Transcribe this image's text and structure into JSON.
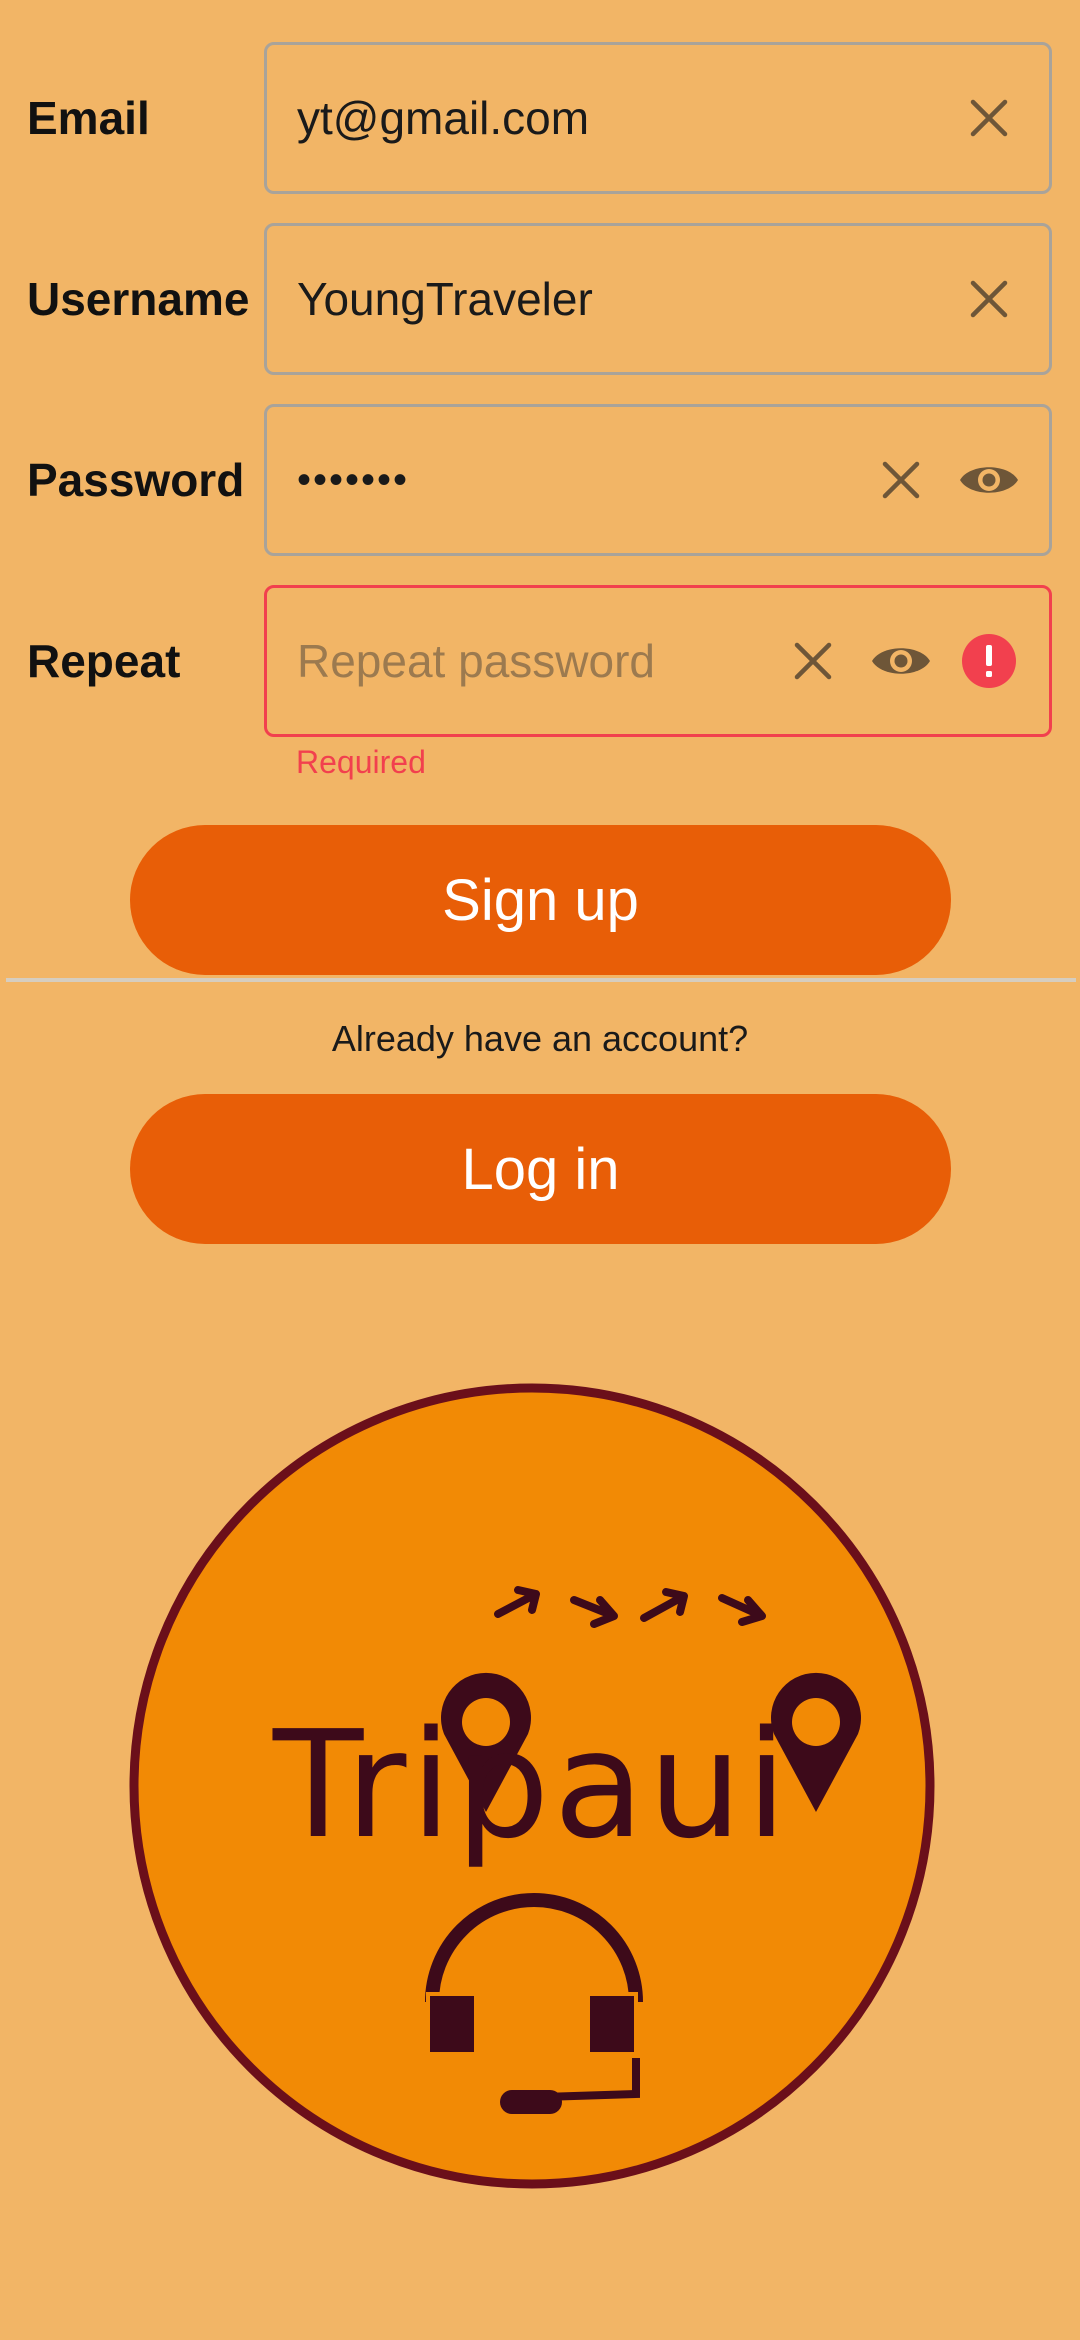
{
  "form": {
    "email": {
      "label": "Email",
      "value": "yt@gmail.com"
    },
    "username": {
      "label": "Username",
      "value": "YoungTraveler"
    },
    "password": {
      "label": "Password",
      "value": "passwor"
    },
    "repeat": {
      "label": "Repeat",
      "value": "",
      "placeholder": "Repeat password",
      "error": "Required"
    }
  },
  "buttons": {
    "signup": "Sign up",
    "login": "Log in"
  },
  "prompt": "Already have an account?",
  "logo": {
    "text": "Tripaui"
  },
  "icons": {
    "clear": "close-icon",
    "visibility": "eye-icon",
    "error": "error-icon"
  },
  "colors": {
    "background": "#f2b566",
    "button": "#e85e07",
    "error": "#f2404e",
    "logo_fill": "#f28a05",
    "logo_dark": "#3d0a1a"
  }
}
